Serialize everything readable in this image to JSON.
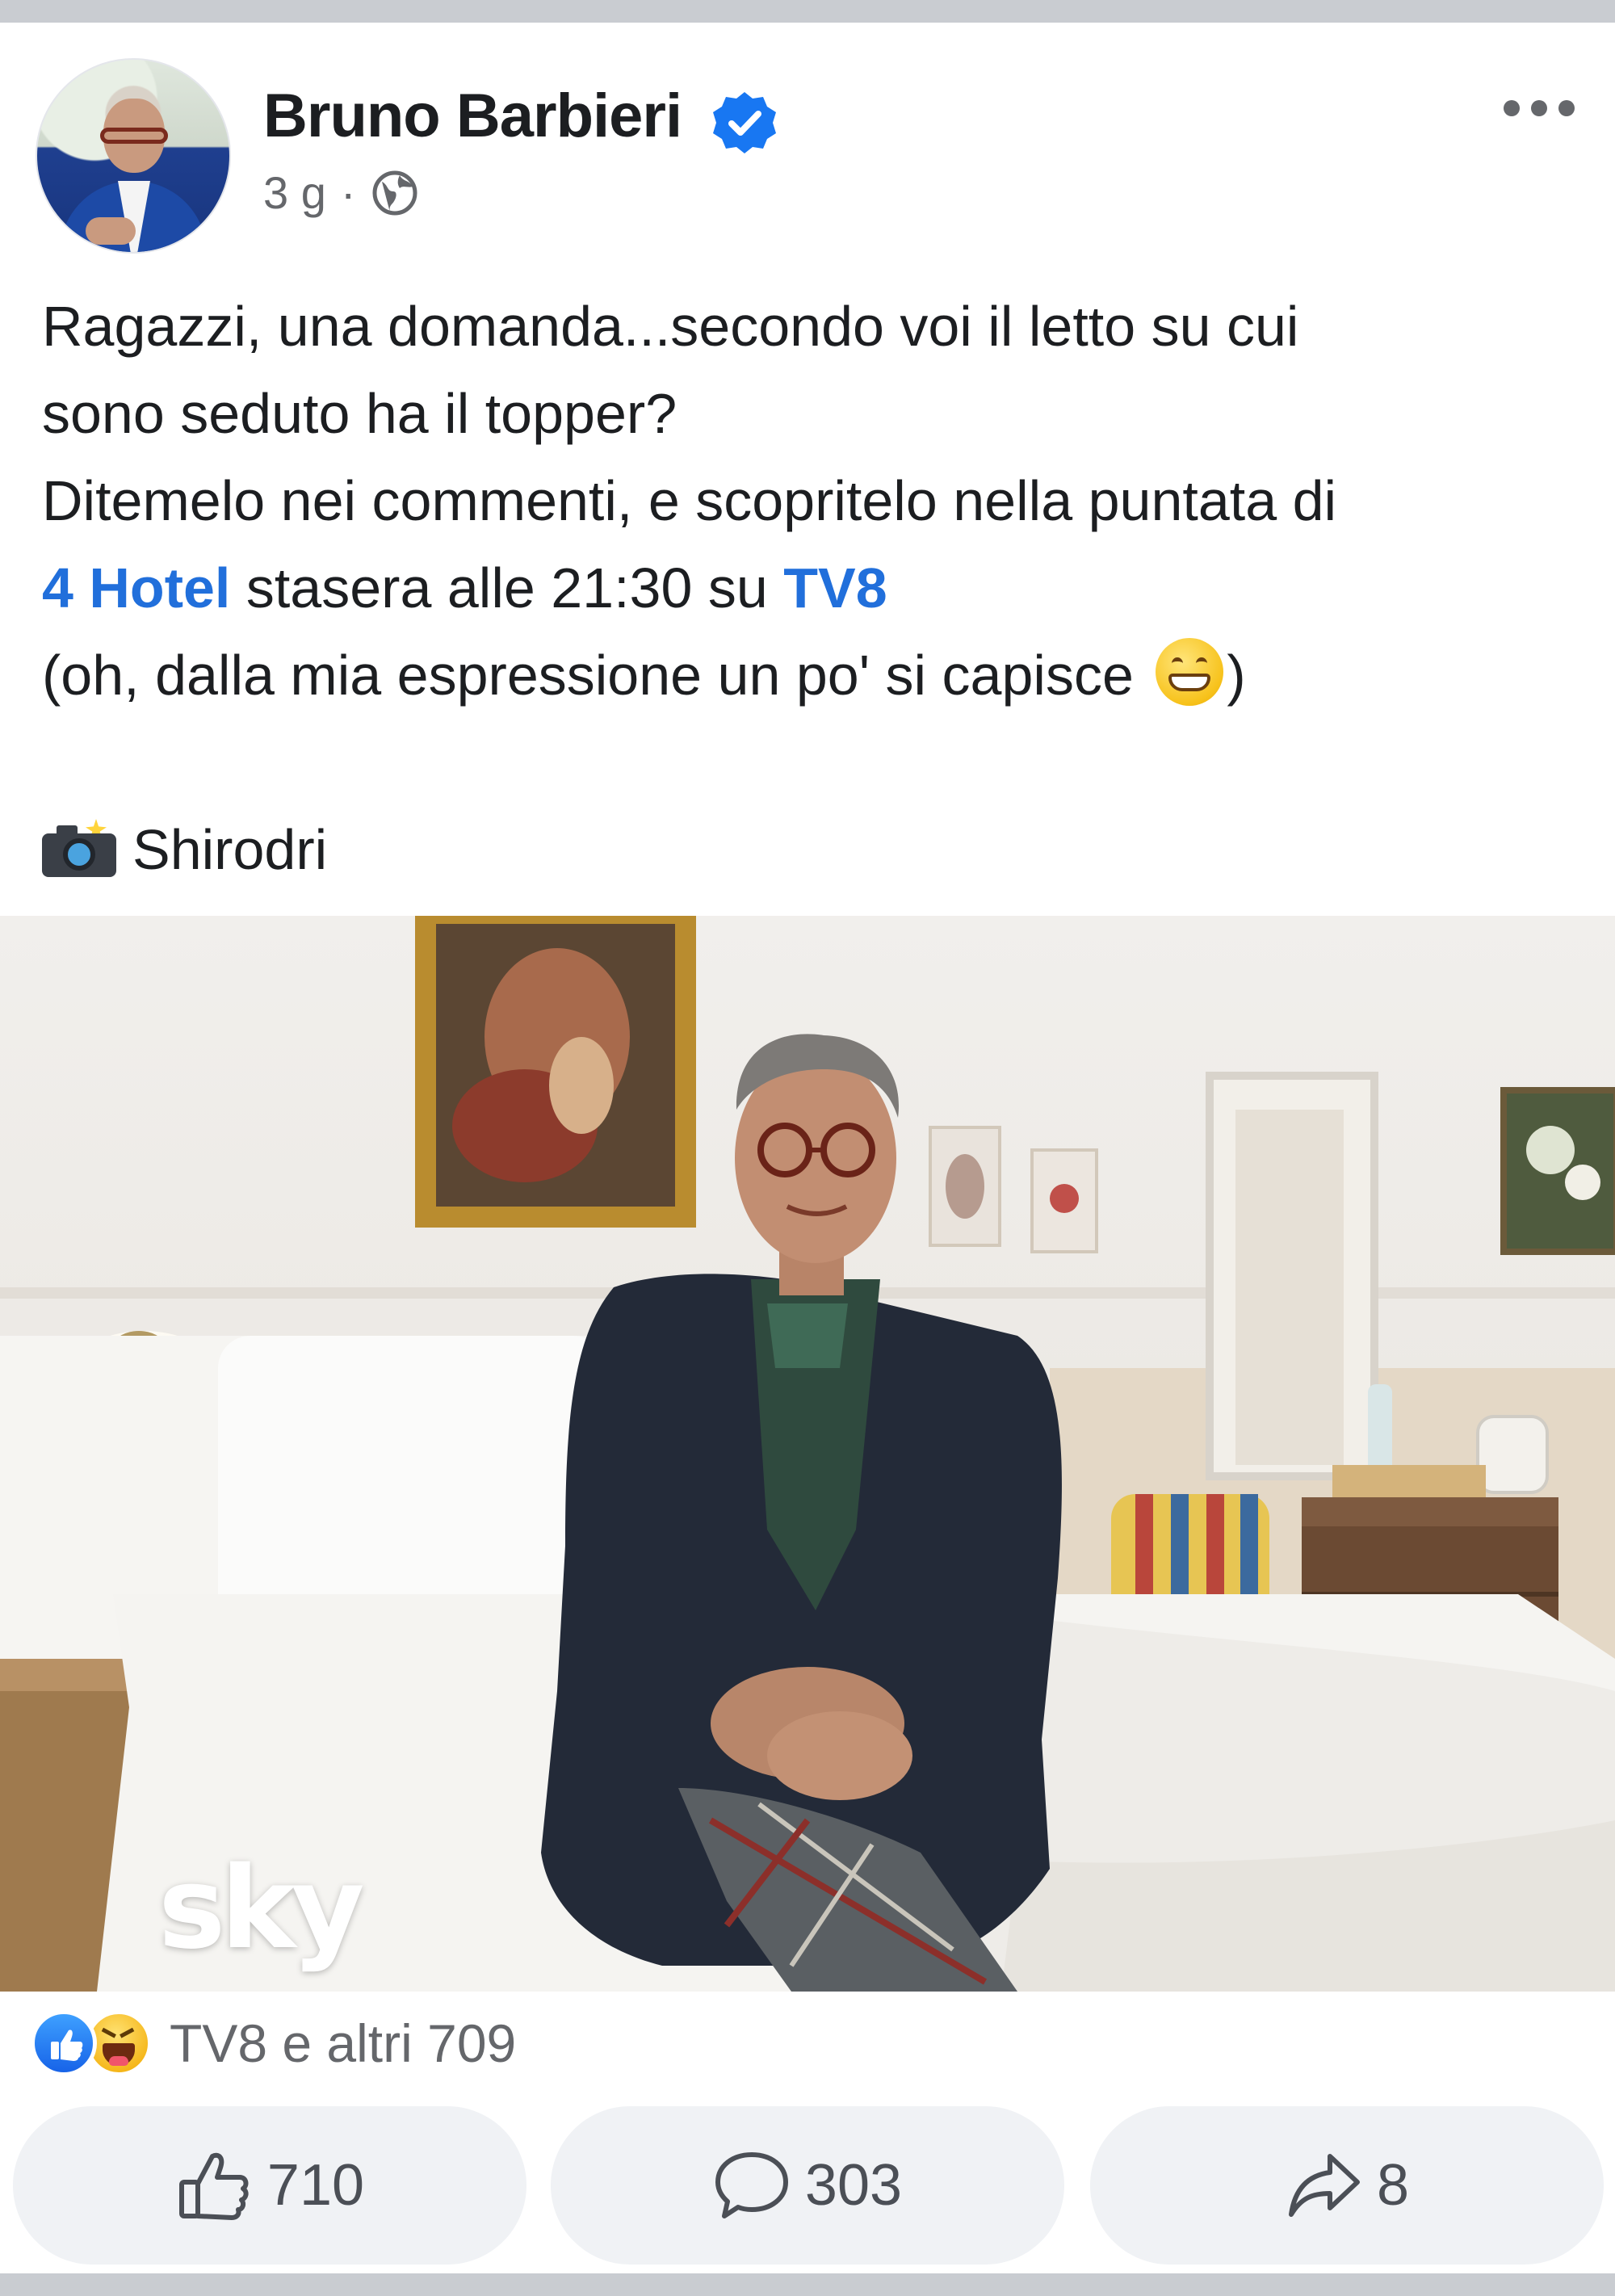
{
  "post": {
    "author": "Bruno Barbieri",
    "verified": true,
    "time": "3 g",
    "separator": "·",
    "audience_icon": "globe-icon",
    "text_lines": [
      "Ragazzi, una domanda...secondo voi il letto su cui",
      "sono seduto ha il topper?",
      "Ditemelo nei commenti, e scopritelo nella puntata di"
    ],
    "line4": {
      "link1": "4 Hotel",
      "mid": " stasera alle 21:30 su ",
      "link2": "TV8"
    },
    "line5": {
      "before": "(oh, dalla mia espressione un po' si capisce ",
      "emoji": "grinning-face-emoji",
      "after": ")"
    },
    "credit": "Shirodri",
    "photo_watermark": "sky"
  },
  "reactions": {
    "summary": "TV8 e altri 709",
    "icons": [
      "like-reaction",
      "haha-reaction"
    ]
  },
  "actions": {
    "like_count": "710",
    "comment_count": "303",
    "share_count": "8"
  },
  "colors": {
    "link": "#216fdb",
    "verified": "#1877f2",
    "secondary_text": "#65676b",
    "button_bg": "#f0f2f5"
  }
}
